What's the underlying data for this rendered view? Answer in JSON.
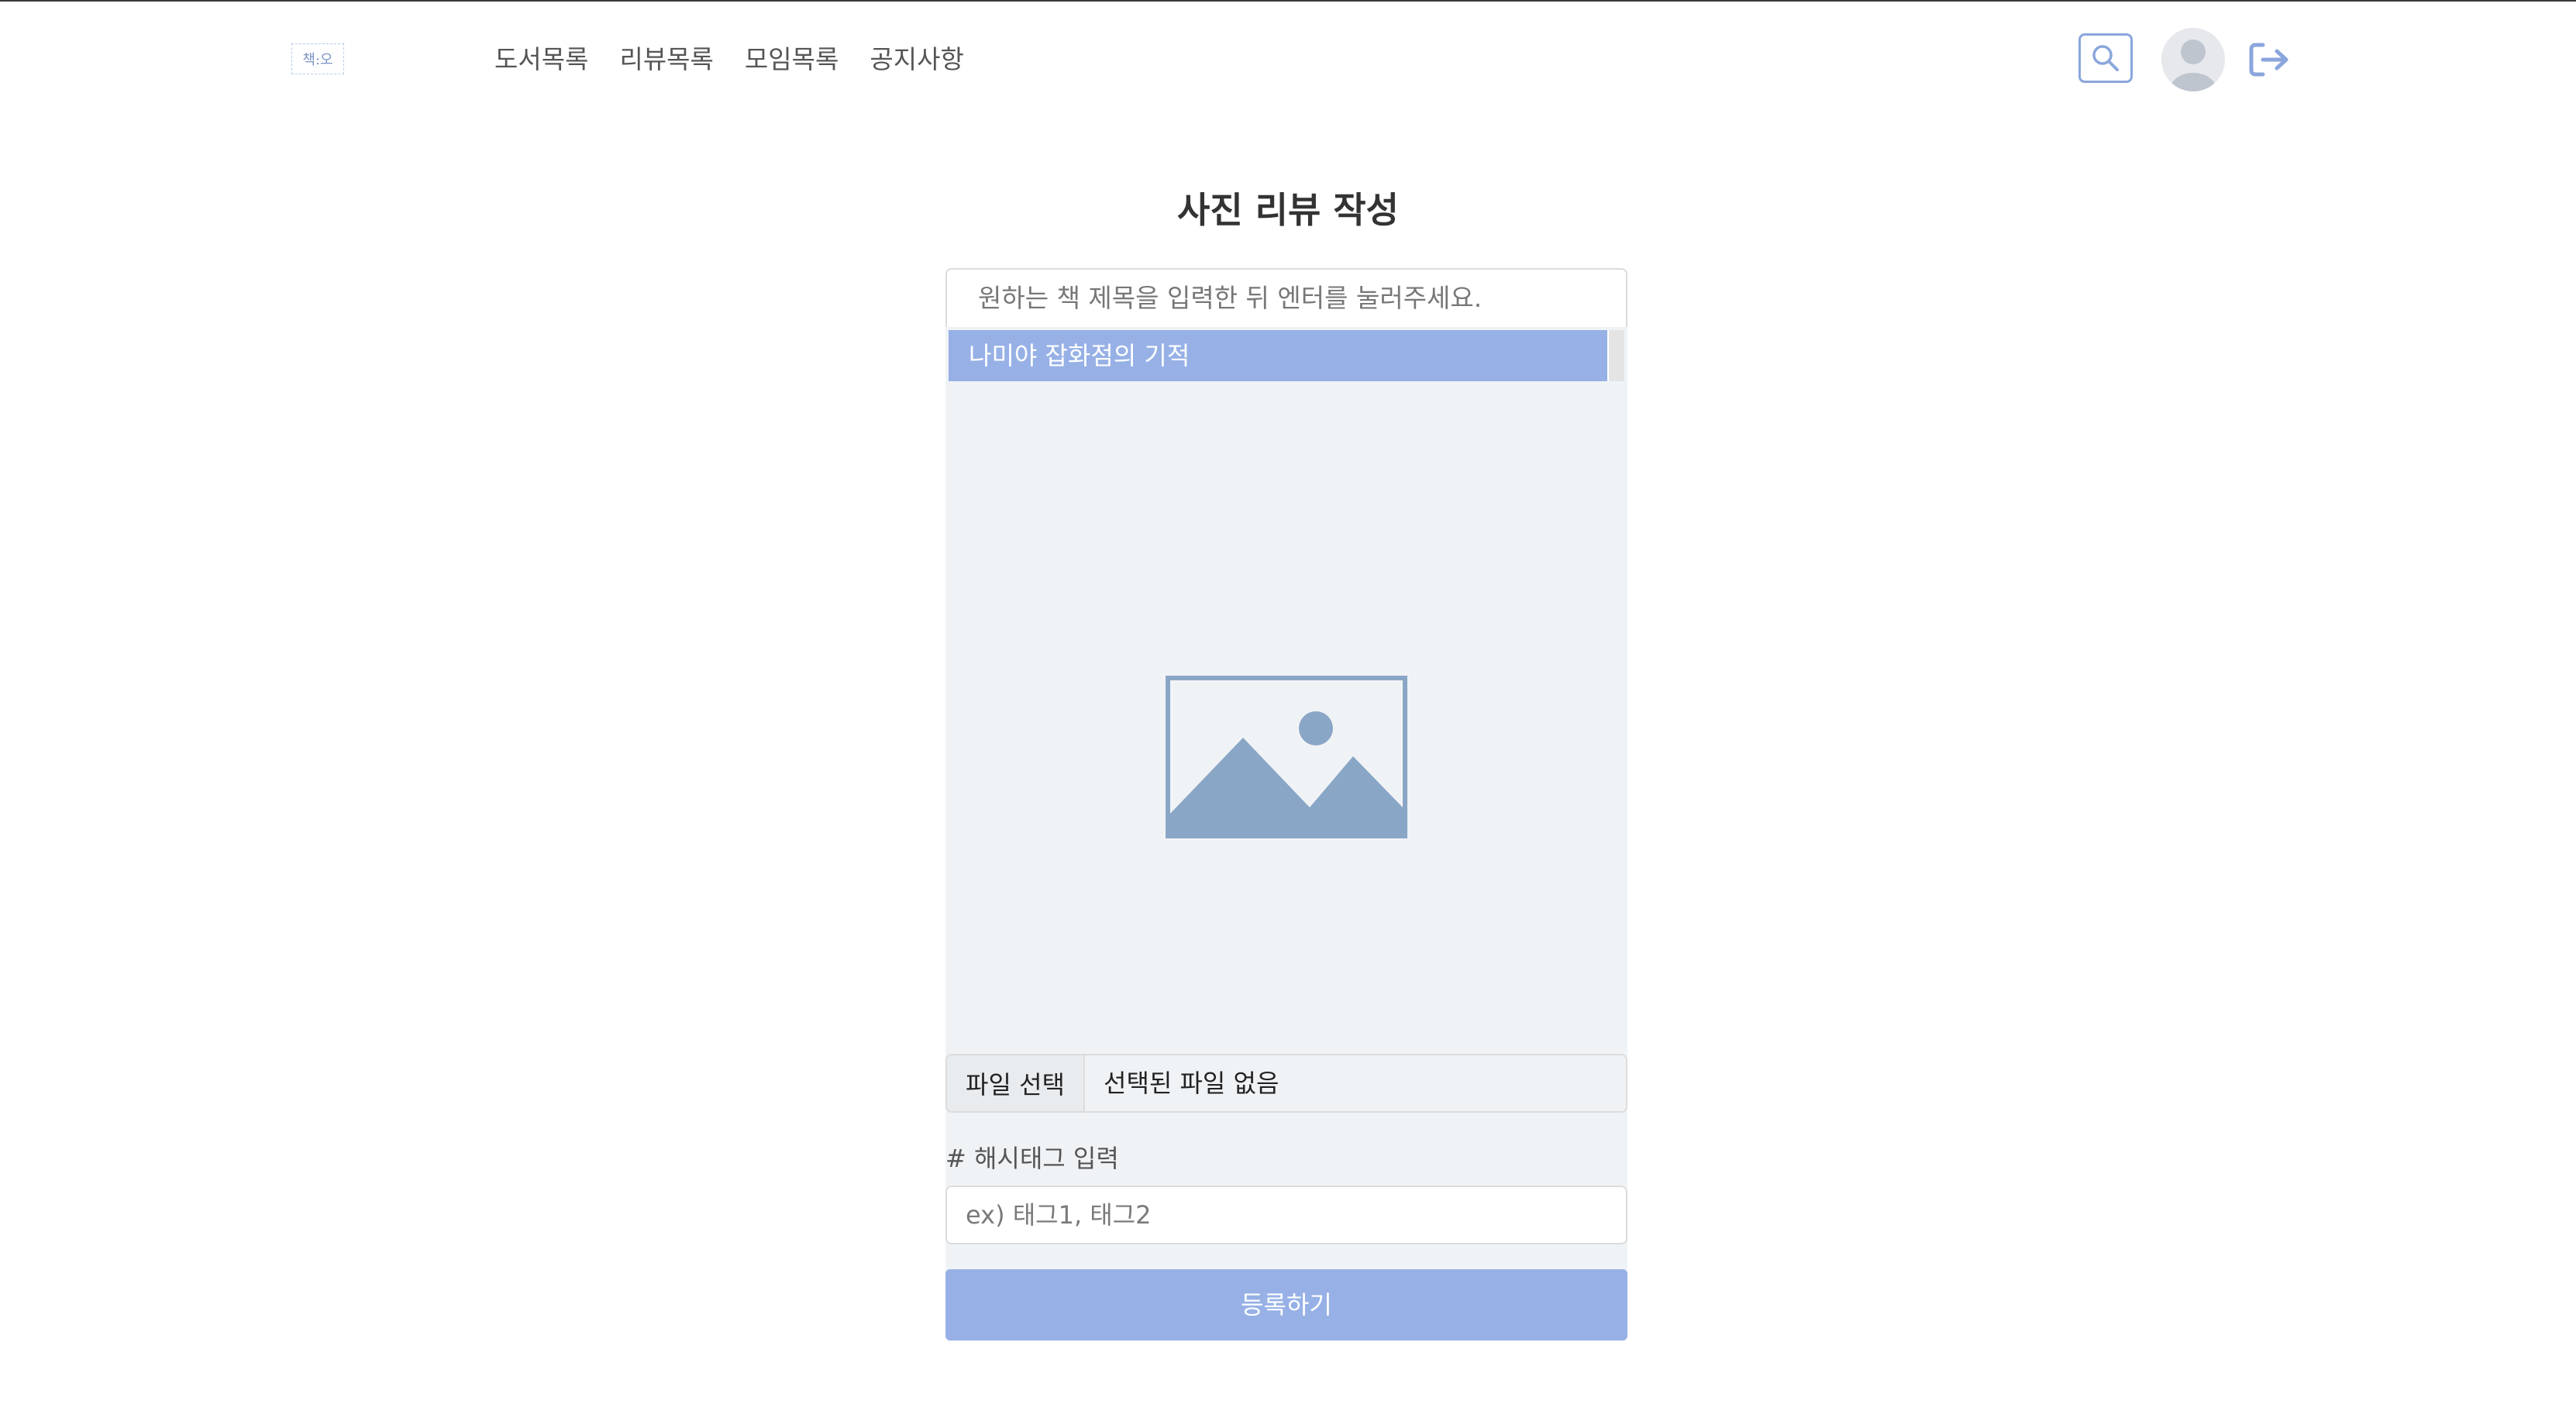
{
  "header": {
    "logo_text": "책:오",
    "nav": [
      "도서목록",
      "리뷰목록",
      "모임목록",
      "공지사항"
    ],
    "icons": {
      "search": "search-icon",
      "avatar": "user-icon",
      "logout": "logout-icon"
    },
    "accent_color": "#8aa6dc"
  },
  "main": {
    "title": "사진 리뷰 작성",
    "book_search": {
      "placeholder": "원하는 책 제목을 입력한 뒤 엔터를 눌러주세요.",
      "value": "",
      "suggestion": "나미야 잡화점의 기적"
    },
    "preview_icon": "image-placeholder-icon",
    "file": {
      "button_label": "파일 선택",
      "status": "선택된 파일 없음"
    },
    "hashtag": {
      "label": "# 해시태그 입력",
      "placeholder": "ex) 태그1, 태그2",
      "value": ""
    },
    "submit_label": "등록하기",
    "submit_color": "#97b1e6"
  }
}
